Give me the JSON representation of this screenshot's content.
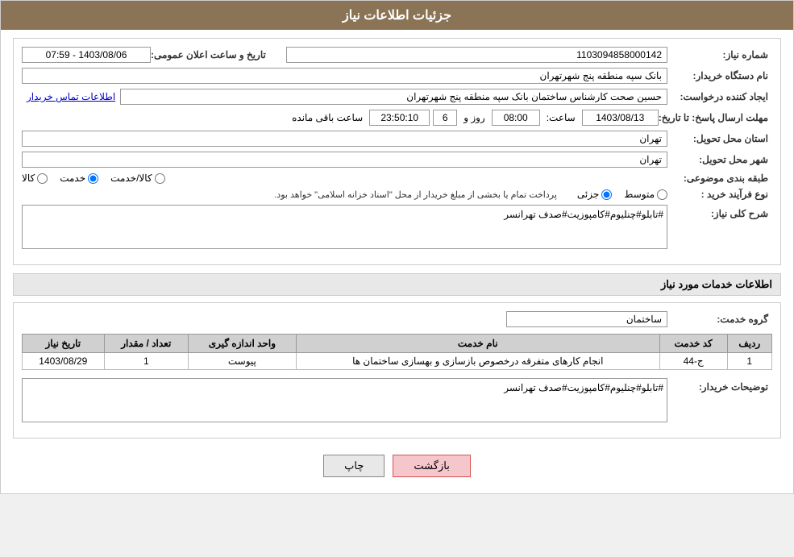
{
  "header": {
    "title": "جزئیات اطلاعات نیاز"
  },
  "fields": {
    "need_number_label": "شماره نیاز:",
    "need_number_value": "1103094858000142",
    "org_name_label": "نام دستگاه خریدار:",
    "org_name_value": "بانک سپه منطقه پنج شهرتهران",
    "creator_label": "ایجاد کننده درخواست:",
    "creator_value": "حسین صحت کارشناس ساختمان بانک سپه منطقه پنج شهرتهران",
    "contact_link": "اطلاعات تماس خریدار",
    "deadline_label": "مهلت ارسال پاسخ: تا تاریخ:",
    "deadline_date": "1403/08/13",
    "deadline_time_label": "ساعت:",
    "deadline_time": "08:00",
    "deadline_days_label": "روز و",
    "deadline_days": "6",
    "deadline_remaining_label": "ساعت باقی مانده",
    "deadline_remaining": "23:50:10",
    "pub_date_label": "تاریخ و ساعت اعلان عمومی:",
    "pub_date_value": "1403/08/06 - 07:59",
    "province_label": "استان محل تحویل:",
    "province_value": "تهران",
    "city_label": "شهر محل تحویل:",
    "city_value": "تهران",
    "category_label": "طبقه بندی موضوعی:",
    "category_options": [
      "کالا",
      "خدمت",
      "کالا/خدمت"
    ],
    "category_selected": "خدمت",
    "process_label": "نوع فرآیند خرید :",
    "process_options": [
      "جزئی",
      "متوسط"
    ],
    "process_note": "پرداخت تمام یا بخشی از مبلغ خریدار از محل \"اسناد خزانه اسلامی\" خواهد بود.",
    "need_desc_label": "شرح کلی نیاز:",
    "need_desc_value": "#تابلو#چنلیوم#کامپوزیت#صدف تهرانسر"
  },
  "services_section": {
    "title": "اطلاعات خدمات مورد نیاز",
    "group_label": "گروه خدمت:",
    "group_value": "ساختمان",
    "table": {
      "headers": [
        "ردیف",
        "کد خدمت",
        "نام خدمت",
        "واحد اندازه گیری",
        "تعداد / مقدار",
        "تاریخ نیاز"
      ],
      "rows": [
        {
          "row_num": "1",
          "code": "ج-44",
          "name": "انجام کارهای متفرقه درخصوص بازسازی و بهسازی ساختمان ها",
          "unit": "پیوست",
          "quantity": "1",
          "date": "1403/08/29"
        }
      ]
    }
  },
  "buyer_desc": {
    "label": "توضیحات خریدار:",
    "value": "#تابلو#چنلیوم#کامپوزیت#صدف تهرانسر"
  },
  "buttons": {
    "print": "چاپ",
    "back": "بازگشت"
  }
}
